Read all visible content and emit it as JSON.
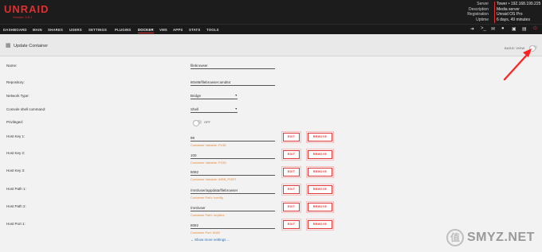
{
  "app": {
    "logo": "UNRAID",
    "version": "Version: 6.8.1"
  },
  "server_info": {
    "labels": [
      "Server",
      "Description",
      "Registration",
      "Uptime"
    ],
    "values": [
      "Tower • 192.168.199.225",
      "Media server",
      "Unraid OS Pro",
      "6 days, 49 minutes"
    ]
  },
  "nav": {
    "items": [
      "DASHBOARD",
      "MAIN",
      "SHARES",
      "USERS",
      "SETTINGS",
      "PLUGINS",
      "DOCKER",
      "VMS",
      "APPS",
      "STATS",
      "TOOLS"
    ],
    "active": "DOCKER",
    "icons": [
      "logout-icon",
      "terminal-icon",
      "feedback-icon",
      "help-icon",
      "info-icon",
      "log-icon",
      "power-icon"
    ]
  },
  "panel": {
    "title": "Update Container",
    "basic_view": "BASIC VIEW"
  },
  "form": {
    "name": {
      "label": "Name:",
      "value": "filebrowser"
    },
    "repository": {
      "label": "Repository:",
      "value": "80x86/filebrowser:amd64"
    },
    "network_type": {
      "label": "Network Type:",
      "value": "Bridge"
    },
    "console_shell": {
      "label": "Console shell command:",
      "value": "Shell"
    },
    "privileged": {
      "label": "Privileged:",
      "value": "OFF"
    },
    "host_key_1": {
      "label": "Host Key 1:",
      "value": "99",
      "hint": "Container Variable: PUID"
    },
    "host_key_2": {
      "label": "Host Key 2:",
      "value": "100",
      "hint": "Container Variable: PGID"
    },
    "host_key_3": {
      "label": "Host Key 3:",
      "value": "8082",
      "hint": "Container Variable: WEB_PORT"
    },
    "host_path_1": {
      "label": "Host Path 1:",
      "value": "/mnt/user/appdata/filebrowser",
      "hint": "Container Path: /config"
    },
    "host_path_2": {
      "label": "Host Path 2:",
      "value": "/mnt/user",
      "hint": "Container Path: /myfiles"
    },
    "host_port_1": {
      "label": "Host Port 1:",
      "value": "8082",
      "hint": "Container Port: 8082"
    }
  },
  "buttons": {
    "edit": "EDIT",
    "remove": "REMOVE"
  },
  "show_more": "Show more settings ...",
  "watermark": {
    "badge": "值",
    "text": "SMYZ.NET"
  },
  "colors": {
    "brand": "#e02f2f",
    "hint": "#e6893a",
    "link": "#2a6fb8"
  }
}
